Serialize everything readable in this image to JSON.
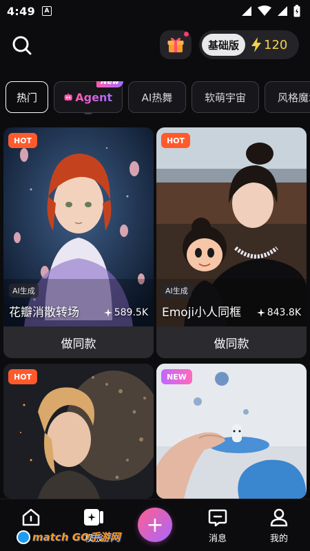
{
  "status": {
    "time": "4:49",
    "notif_icon": "A"
  },
  "header": {
    "plan_label": "基础版",
    "credits": "120"
  },
  "tabs": [
    {
      "label": "热门",
      "active": true
    },
    {
      "label": "Agent",
      "badge": "New"
    },
    {
      "label": "AI热舞"
    },
    {
      "label": "软萌宇宙"
    },
    {
      "label": "风格魔术"
    }
  ],
  "cards": [
    {
      "badge": "HOT",
      "ai_tag": "AI生成",
      "title": "花瓣消散转场",
      "count": "589.5K",
      "button": "做同款"
    },
    {
      "badge": "HOT",
      "ai_tag": "AI生成",
      "title": "Emoji小人同框",
      "count": "843.8K",
      "button": "做同款"
    },
    {
      "badge": "HOT"
    },
    {
      "badge": "NEW"
    }
  ],
  "nav": {
    "templates": "模板",
    "messages": "消息",
    "mine": "我的",
    "plus": "+"
  },
  "watermark": "match GO手游网",
  "colors": {
    "accent_pink": "#ff5bb0",
    "accent_purple": "#a56bff",
    "hot": "#ff5a2c",
    "credits": "#f5d14a"
  }
}
